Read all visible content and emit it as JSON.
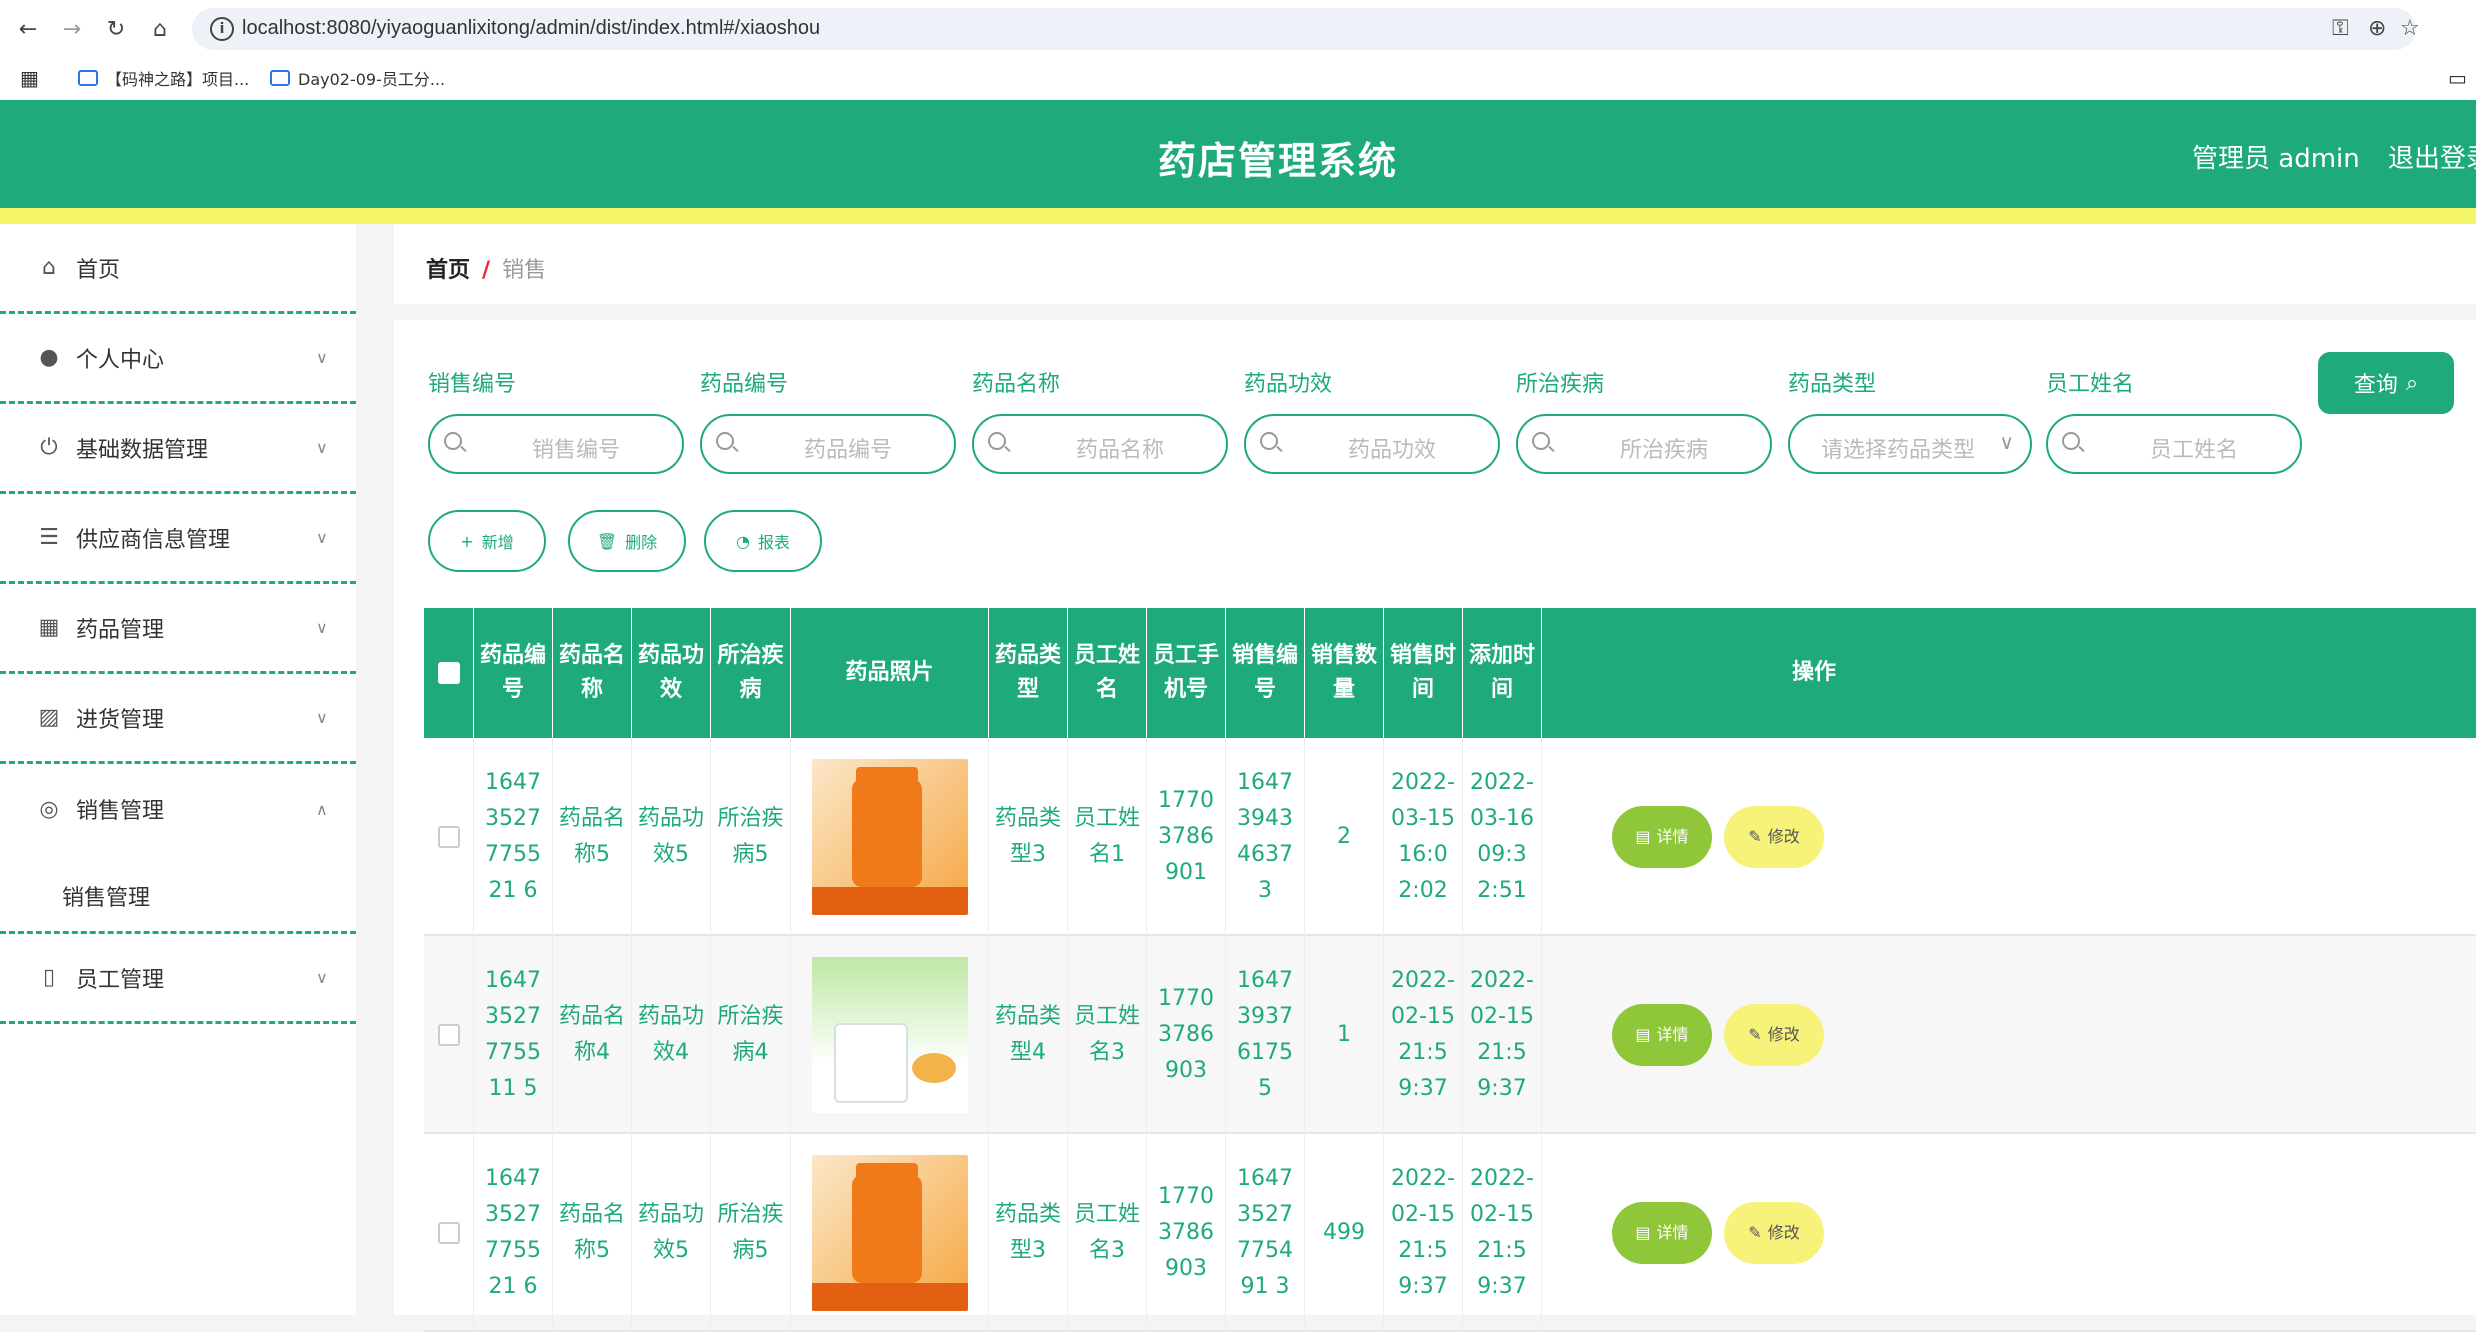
{
  "browser": {
    "url": "localhost:8080/yiyaoguanlixitong/admin/dist/index.html#/xiaoshou",
    "bookmarks": [
      "【码神之路】项目...",
      "Day02-09-员工分..."
    ]
  },
  "header": {
    "title": "药店管理系统",
    "admin_label": "管理员 admin",
    "logout_label": "退出登录"
  },
  "sidebar": {
    "items": [
      {
        "label": "首页",
        "icon": "home-icon"
      },
      {
        "label": "个人中心",
        "icon": "user-icon"
      },
      {
        "label": "基础数据管理",
        "icon": "power-icon"
      },
      {
        "label": "供应商信息管理",
        "icon": "sliders-icon"
      },
      {
        "label": "药品管理",
        "icon": "grid-icon"
      },
      {
        "label": "进货管理",
        "icon": "chart-icon"
      },
      {
        "label": "销售管理",
        "icon": "compass-icon"
      },
      {
        "label": "员工管理",
        "icon": "phone-icon"
      }
    ],
    "subitem": "销售管理"
  },
  "breadcrumb": {
    "home": "首页",
    "sep": "/",
    "current": "销售"
  },
  "filters": [
    {
      "label": "销售编号",
      "placeholder": "销售编号"
    },
    {
      "label": "药品编号",
      "placeholder": "药品编号"
    },
    {
      "label": "药品名称",
      "placeholder": "药品名称"
    },
    {
      "label": "药品功效",
      "placeholder": "药品功效"
    },
    {
      "label": "所治疾病",
      "placeholder": "所治疾病"
    },
    {
      "label": "药品类型",
      "placeholder": "请选择药品类型"
    },
    {
      "label": "员工姓名",
      "placeholder": "员工姓名"
    }
  ],
  "query_label": "查询",
  "actions": {
    "add": "新增",
    "delete": "删除",
    "report": "报表"
  },
  "table": {
    "headers": [
      "药品编号",
      "药品名称",
      "药品功效",
      "所治疾病",
      "药品照片",
      "药品类型",
      "员工姓名",
      "员工手机号",
      "销售编号",
      "销售数量",
      "销售时间",
      "添加时间",
      "操作"
    ],
    "rows": [
      {
        "drug_no": "16473527775521 6",
        "name": "药品名称5",
        "effect": "药品功效5",
        "disease": "所治疾病5",
        "photo": "orange",
        "type": "药品类型3",
        "staff": "员工姓名1",
        "phone": "17703786901",
        "sale_no": "1647394346373",
        "qty": "2",
        "sale_time": "2022-03-15 16:02:02",
        "add_time": "2022-03-16 09:32:51"
      },
      {
        "drug_no": "16473527775511 5",
        "name": "药品名称4",
        "effect": "药品功效4",
        "disease": "所治疾病4",
        "photo": "green",
        "type": "药品类型4",
        "staff": "员工姓名3",
        "phone": "17703786903",
        "sale_no": "1647393761755",
        "qty": "1",
        "sale_time": "2022-02-15 21:59:37",
        "add_time": "2022-02-15 21:59:37"
      },
      {
        "drug_no": "16473527775521 6",
        "name": "药品名称5",
        "effect": "药品功效5",
        "disease": "所治疾病5",
        "photo": "orange",
        "type": "药品类型3",
        "staff": "员工姓名3",
        "phone": "17703786903",
        "sale_no": "16473527775491 3",
        "qty": "499",
        "sale_time": "2022-02-15 21:59:37",
        "add_time": "2022-02-15 21:59:37"
      }
    ],
    "detail_label": "详情",
    "edit_label": "修改"
  },
  "colors": {
    "primary": "#1eaa7a",
    "accent_yellow": "#f5f56a",
    "detail_btn": "#8fc63a",
    "edit_btn": "#f7f37a"
  }
}
